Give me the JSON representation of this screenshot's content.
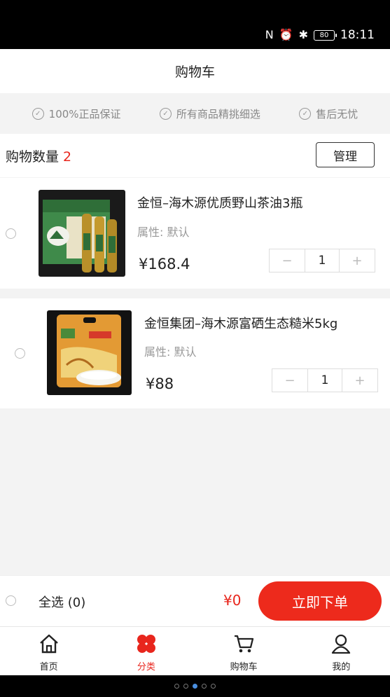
{
  "status_bar": {
    "nfc": "N",
    "alarm": "⏰",
    "bluetooth": "✱",
    "battery": "80",
    "time": "18:11"
  },
  "header": {
    "title": "购物车"
  },
  "guarantees": [
    "100%正品保证",
    "所有商品精挑细选",
    "售后无忧"
  ],
  "cart_summary": {
    "label": "购物数量",
    "count": "2",
    "manage_label": "管理"
  },
  "items": [
    {
      "title": "金恒–海木源优质野山茶油3瓶",
      "attribute": "属性:  默认",
      "price": "¥168.4",
      "quantity": "1",
      "minus": "−",
      "plus": "+"
    },
    {
      "title": "金恒集团–海木源富硒生态糙米5kg",
      "attribute": "属性:  默认",
      "price": "¥88",
      "quantity": "1",
      "minus": "−",
      "plus": "+"
    }
  ],
  "checkout": {
    "select_all": "全选 (0)",
    "total": "¥0",
    "order_button": "立即下单"
  },
  "tabs": [
    {
      "label": "首页",
      "icon": "home-icon",
      "active": false
    },
    {
      "label": "分类",
      "icon": "category-icon",
      "active": true
    },
    {
      "label": "购物车",
      "icon": "cart-icon",
      "active": false
    },
    {
      "label": "我的",
      "icon": "profile-icon",
      "active": false
    }
  ],
  "colors": {
    "accent": "#e8261d",
    "button": "#ed2a1c",
    "background": "#f3f3f3"
  }
}
